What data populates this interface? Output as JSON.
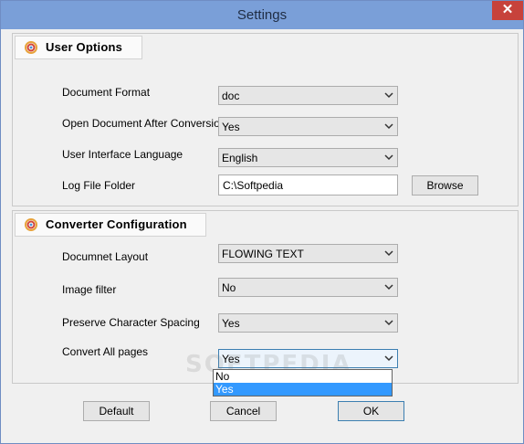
{
  "window": {
    "title": "Settings",
    "close_glyph": "✕"
  },
  "user_options": {
    "title": "User Options",
    "icon": "app-logo-icon",
    "rows": [
      {
        "label": "Document Format",
        "value": "doc"
      },
      {
        "label": "Open Document After Conversion",
        "value": "Yes"
      },
      {
        "label": "User Interface Language",
        "value": "English"
      }
    ],
    "log_folder": {
      "label": "Log File Folder",
      "value": "C:\\Softpedia",
      "browse_label": "Browse"
    }
  },
  "converter": {
    "title": "Converter Configuration",
    "icon": "app-logo-icon",
    "rows": [
      {
        "label": "Documnet Layout",
        "value": "FLOWING TEXT"
      },
      {
        "label": "Image filter",
        "value": "No"
      },
      {
        "label": "Preserve Character Spacing",
        "value": "Yes"
      },
      {
        "label": "Convert All pages",
        "value": "Yes"
      }
    ],
    "dropdown_options": [
      "No",
      "Yes"
    ],
    "dropdown_selected": "Yes"
  },
  "buttons": {
    "default": "Default",
    "cancel": "Cancel",
    "ok": "OK"
  },
  "watermark": "SOFTPEDIA",
  "colors": {
    "title_bar": "#7a9fd8",
    "close": "#c7423b",
    "selection": "#3399ff"
  }
}
